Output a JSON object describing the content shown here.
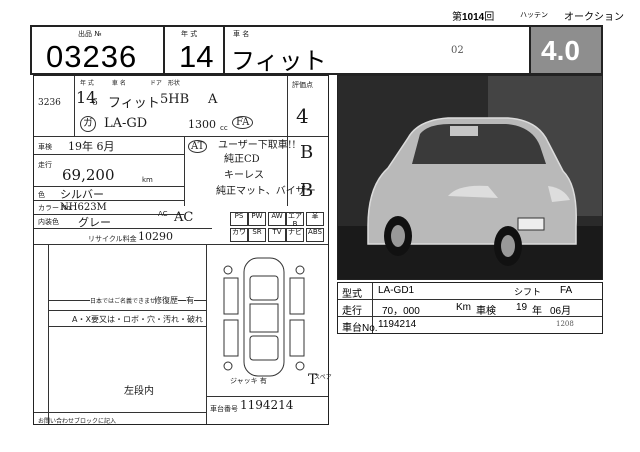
{
  "header": {
    "lot_label": "出品 №",
    "year_label": "年 式",
    "car_name_label": "車 名",
    "lot_no": "03236",
    "year": "14",
    "car_name": "フィット",
    "session_prefix": "第",
    "session_no": "1014",
    "session_suffix": "回",
    "hattenten": "ハッテン",
    "auction": "オークション",
    "handwritten_mark": "02",
    "grade_score": "4.0"
  },
  "sheet": {
    "lot_no_small": "3236",
    "year_field": "14",
    "year_sub": "6",
    "model_name": "フィット",
    "body_type": "5HB",
    "trans": "A",
    "fuel_label": "ガ",
    "chassis": "LA-GD",
    "displacement": "1300",
    "displacement_unit": "cc",
    "fa": "FA",
    "score_label": "評価点",
    "score": "4",
    "inspection_label": "車検",
    "inspection_value": "19年 6月",
    "mileage_label": "走行",
    "mileage_value": "69,200",
    "mileage_unit": "km",
    "color_label": "色",
    "color_value": "シルバー",
    "color_no_label": "カラー No.",
    "color_no": "NH623M",
    "trim_label": "内装色",
    "trim_value": "グレー",
    "ac_label": "AC",
    "ac_value": "AC",
    "recycle_label": "リサイクル料金",
    "recycle_value": "10290",
    "at_mark": "AT",
    "notes": [
      "ユーザー下取車!!",
      "純正CD",
      "キーレス",
      "純正マット、バイザー"
    ],
    "interior_grade": "B",
    "exterior_grade": "B",
    "equipment": [
      "PS",
      "PW",
      "AW",
      "革",
      "カワ",
      "SR",
      "TV",
      "ナビ",
      "エアB",
      "ABS"
    ],
    "repair_label": "修復歴",
    "repair_value": "有",
    "japan_only_label": "日本ではご名義できません",
    "defects_label": "A・X要又は・ロボ・穴・汚れ・破れ",
    "handwriting_bottom": "左段内",
    "chassis_no_label": "車台番号",
    "chassis_no_hand": "1194214",
    "spare_label": "スペア",
    "spare_value": "T",
    "jack_label": "ジャッキ 有",
    "footer_note": "お問い合わせブロックに記入"
  },
  "photo_panel": {
    "model_label": "型式",
    "model_value": "LA-GD1",
    "shift_label": "シフト",
    "shift_value": "FA",
    "mileage_label": "走行",
    "mileage_value": "70，000",
    "mileage_unit": "Km",
    "inspection_label": "車検",
    "inspection_year": "19",
    "inspection_year_unit": "年",
    "inspection_month": "06月",
    "chassis_label": "車台No.",
    "chassis_value": "1194214",
    "corner_note": "1208"
  }
}
